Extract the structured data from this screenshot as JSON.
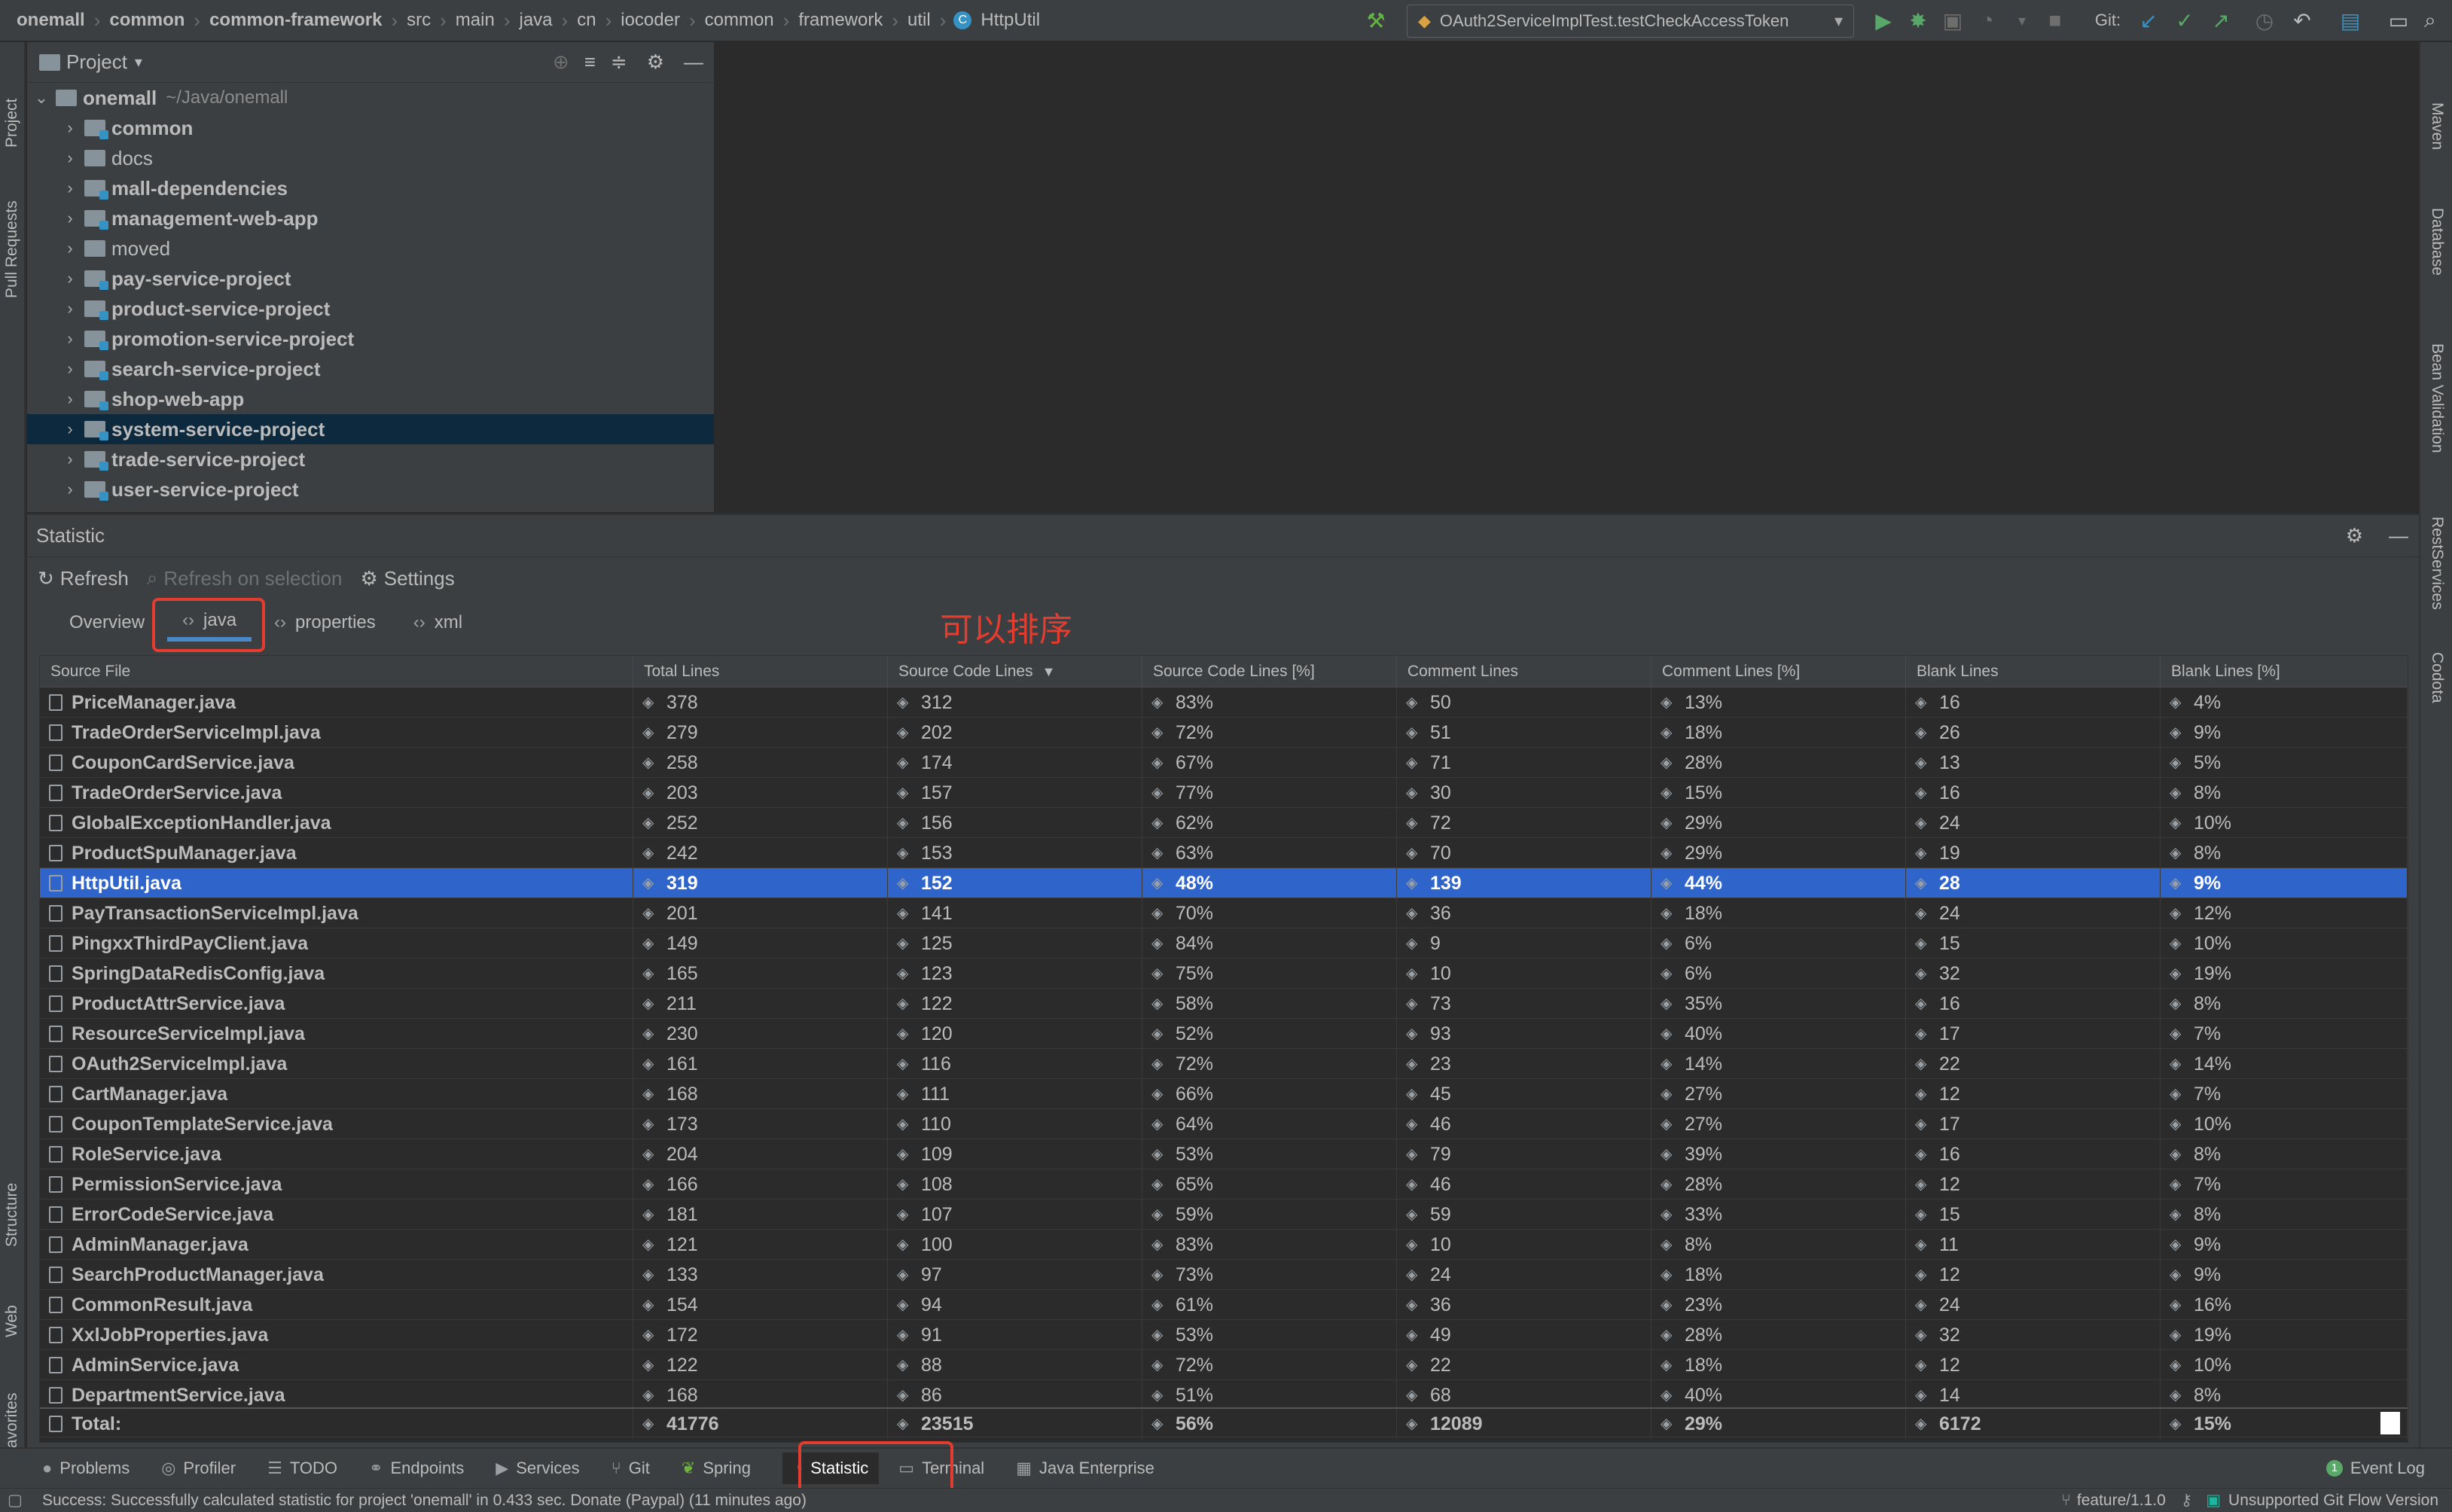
{
  "breadcrumbs": [
    "onemall",
    "common",
    "common-framework",
    "src",
    "main",
    "java",
    "cn",
    "iocoder",
    "common",
    "framework",
    "util",
    "HttpUtil"
  ],
  "run_config": "OAuth2ServiceImplTest.testCheckAccessToken",
  "git_label": "Git:",
  "left_strip": {
    "project": "Project",
    "pull_requests": "Pull Requests",
    "structure": "Structure",
    "web": "Web",
    "favorites": "Favorites"
  },
  "right_strip": {
    "maven": "Maven",
    "database": "Database",
    "bean_validation": "Bean Validation",
    "rest_services": "RestServices",
    "codota": "Codota"
  },
  "project_panel": {
    "title": "Project",
    "root": {
      "name": "onemall",
      "path": "~/Java/onemall"
    },
    "items": [
      {
        "name": "common",
        "module": true
      },
      {
        "name": "docs",
        "module": false
      },
      {
        "name": "mall-dependencies",
        "module": true
      },
      {
        "name": "management-web-app",
        "module": true
      },
      {
        "name": "moved",
        "module": false
      },
      {
        "name": "pay-service-project",
        "module": true
      },
      {
        "name": "product-service-project",
        "module": true
      },
      {
        "name": "promotion-service-project",
        "module": true
      },
      {
        "name": "search-service-project",
        "module": true
      },
      {
        "name": "shop-web-app",
        "module": true
      },
      {
        "name": "system-service-project",
        "module": true,
        "selected": true
      },
      {
        "name": "trade-service-project",
        "module": true
      },
      {
        "name": "user-service-project",
        "module": true
      }
    ]
  },
  "statistic": {
    "title": "Statistic",
    "toolbar": {
      "refresh": "Refresh",
      "refresh_on_selection": "Refresh on selection",
      "settings": "Settings"
    },
    "tabs": [
      "Overview",
      "java",
      "properties",
      "xml"
    ],
    "active_tab": "java",
    "annotation": "可以排序",
    "columns": [
      "Source File",
      "Total Lines",
      "Source Code Lines",
      "Source Code Lines [%]",
      "Comment Lines",
      "Comment Lines [%]",
      "Blank Lines",
      "Blank Lines [%]"
    ],
    "sort_indicator": "▼",
    "rows": [
      [
        "PriceManager.java",
        "378",
        "312",
        "83%",
        "50",
        "13%",
        "16",
        "4%"
      ],
      [
        "TradeOrderServiceImpl.java",
        "279",
        "202",
        "72%",
        "51",
        "18%",
        "26",
        "9%"
      ],
      [
        "CouponCardService.java",
        "258",
        "174",
        "67%",
        "71",
        "28%",
        "13",
        "5%"
      ],
      [
        "TradeOrderService.java",
        "203",
        "157",
        "77%",
        "30",
        "15%",
        "16",
        "8%"
      ],
      [
        "GlobalExceptionHandler.java",
        "252",
        "156",
        "62%",
        "72",
        "29%",
        "24",
        "10%"
      ],
      [
        "ProductSpuManager.java",
        "242",
        "153",
        "63%",
        "70",
        "29%",
        "19",
        "8%"
      ],
      [
        "HttpUtil.java",
        "319",
        "152",
        "48%",
        "139",
        "44%",
        "28",
        "9%"
      ],
      [
        "PayTransactionServiceImpl.java",
        "201",
        "141",
        "70%",
        "36",
        "18%",
        "24",
        "12%"
      ],
      [
        "PingxxThirdPayClient.java",
        "149",
        "125",
        "84%",
        "9",
        "6%",
        "15",
        "10%"
      ],
      [
        "SpringDataRedisConfig.java",
        "165",
        "123",
        "75%",
        "10",
        "6%",
        "32",
        "19%"
      ],
      [
        "ProductAttrService.java",
        "211",
        "122",
        "58%",
        "73",
        "35%",
        "16",
        "8%"
      ],
      [
        "ResourceServiceImpl.java",
        "230",
        "120",
        "52%",
        "93",
        "40%",
        "17",
        "7%"
      ],
      [
        "OAuth2ServiceImpl.java",
        "161",
        "116",
        "72%",
        "23",
        "14%",
        "22",
        "14%"
      ],
      [
        "CartManager.java",
        "168",
        "111",
        "66%",
        "45",
        "27%",
        "12",
        "7%"
      ],
      [
        "CouponTemplateService.java",
        "173",
        "110",
        "64%",
        "46",
        "27%",
        "17",
        "10%"
      ],
      [
        "RoleService.java",
        "204",
        "109",
        "53%",
        "79",
        "39%",
        "16",
        "8%"
      ],
      [
        "PermissionService.java",
        "166",
        "108",
        "65%",
        "46",
        "28%",
        "12",
        "7%"
      ],
      [
        "ErrorCodeService.java",
        "181",
        "107",
        "59%",
        "59",
        "33%",
        "15",
        "8%"
      ],
      [
        "AdminManager.java",
        "121",
        "100",
        "83%",
        "10",
        "8%",
        "11",
        "9%"
      ],
      [
        "SearchProductManager.java",
        "133",
        "97",
        "73%",
        "24",
        "18%",
        "12",
        "9%"
      ],
      [
        "CommonResult.java",
        "154",
        "94",
        "61%",
        "36",
        "23%",
        "24",
        "16%"
      ],
      [
        "XxlJobProperties.java",
        "172",
        "91",
        "53%",
        "49",
        "28%",
        "32",
        "19%"
      ],
      [
        "AdminService.java",
        "122",
        "88",
        "72%",
        "22",
        "18%",
        "12",
        "10%"
      ],
      [
        "DepartmentService.java",
        "168",
        "86",
        "51%",
        "68",
        "40%",
        "14",
        "8%"
      ]
    ],
    "selected_row": 6,
    "total": [
      "Total:",
      "41776",
      "23515",
      "56%",
      "12089",
      "29%",
      "6172",
      "15%"
    ]
  },
  "bottom_tools": [
    "Problems",
    "Profiler",
    "TODO",
    "Endpoints",
    "Services",
    "Git",
    "Spring",
    "Statistic",
    "Terminal",
    "Java Enterprise"
  ],
  "event_log": {
    "badge": "1",
    "label": "Event Log"
  },
  "status": {
    "message": "Success: Successfully calculated statistic for project 'onemall' in 0.433 sec. Donate (Paypal) (11 minutes ago)",
    "branch": "feature/1.1.0",
    "git_flow": "Unsupported Git Flow Version"
  },
  "colors": {
    "accent": "#2f65ca",
    "annotation": "#e43c2e",
    "selection_tree": "#0d293e"
  }
}
